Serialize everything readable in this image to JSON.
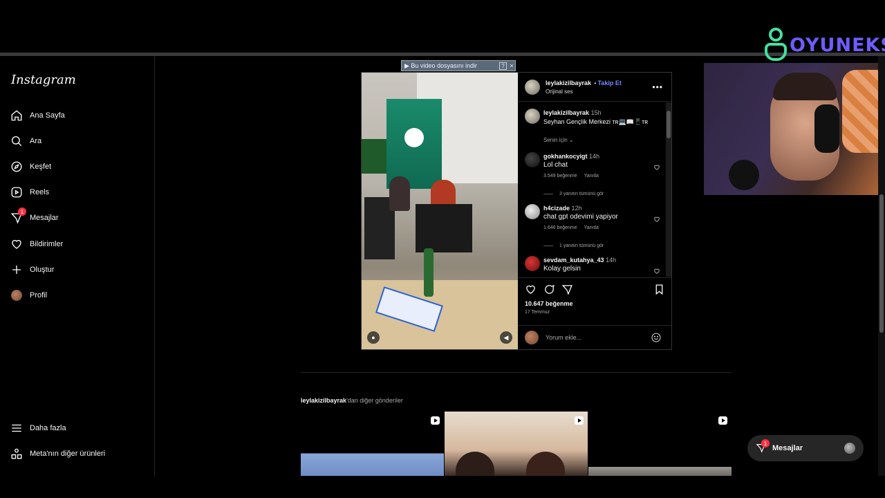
{
  "sidebar": {
    "logo": "Instagram",
    "items": [
      {
        "label": "Ana Sayfa",
        "icon": "home-icon"
      },
      {
        "label": "Ara",
        "icon": "search-icon"
      },
      {
        "label": "Keşfet",
        "icon": "compass-icon"
      },
      {
        "label": "Reels",
        "icon": "reels-icon"
      },
      {
        "label": "Mesajlar",
        "icon": "send-icon",
        "badge": "1"
      },
      {
        "label": "Bildirimler",
        "icon": "heart-icon"
      },
      {
        "label": "Oluştur",
        "icon": "plus-icon"
      },
      {
        "label": "Profil",
        "icon": "avatar"
      }
    ],
    "bottom": [
      {
        "label": "Daha fazla",
        "icon": "menu-icon"
      },
      {
        "label": "Meta'nın diğer ürünleri",
        "icon": "apps-icon"
      }
    ]
  },
  "download_bar": {
    "label": "▶ Bu video dosyasını indir",
    "help": "?",
    "close": "×"
  },
  "post": {
    "author": "leylakizilbayrak",
    "follow": "Takip Et",
    "audio": "Orijinal ses",
    "caption_user": "leylakizilbayrak",
    "caption_time": "15h",
    "caption_text": "Seyhan Gençlik Merkezi ᴛʀ💻📖📱ᴛʀ",
    "sort": "Senin için",
    "comments": [
      {
        "user": "gokhankocyigt",
        "time": "14h",
        "text": "Lol chat",
        "likes": "3.549 beğenme",
        "reply": "Yanıtla",
        "replies": "3 yanıtın tümünü gör"
      },
      {
        "user": "h4cizade",
        "time": "12h",
        "text": "chat gpt odevimi yapiyor",
        "likes": "1.646 beğenme",
        "reply": "Yanıtla",
        "replies": "1 yanıtın tümünü gör"
      },
      {
        "user": "sevdam_kutahya_43",
        "time": "14h",
        "text": "Kolay gelsin"
      }
    ],
    "like_count": "10.647 beğenme",
    "date": "17 Temmuz",
    "comment_placeholder": "Yorum ekle..."
  },
  "more_posts": {
    "user": "leylakizilbayrak",
    "suffix": "'dan diğer gönderiler"
  },
  "messages_pill": {
    "label": "Mesajlar",
    "badge": "1"
  },
  "overlay_brand": "OYUNEKS",
  "colors": {
    "accent": "#6c8cff",
    "badge": "#ff3040",
    "brand": "#6f5cff",
    "brand_glyph": "#45e0a0"
  }
}
